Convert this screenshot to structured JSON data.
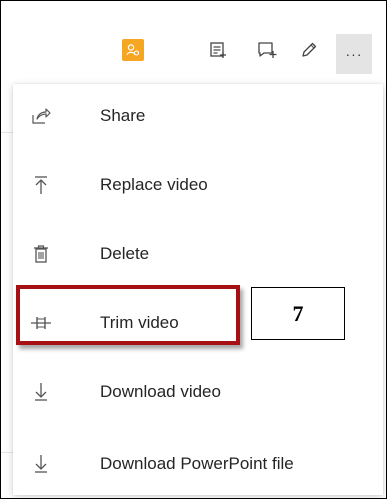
{
  "toolbar": {
    "icons": [
      "person-badge-icon",
      "notes-list-icon",
      "comment-add-icon",
      "pencil-icon"
    ],
    "more_label": "···"
  },
  "menu": {
    "items": [
      {
        "label": "Share",
        "icon": "share-icon"
      },
      {
        "label": "Replace video",
        "icon": "upload-icon"
      },
      {
        "label": "Delete",
        "icon": "trash-icon"
      },
      {
        "label": "Trim video",
        "icon": "trim-icon"
      },
      {
        "label": "Download video",
        "icon": "download-icon"
      },
      {
        "label": "Download PowerPoint file",
        "icon": "download-icon"
      }
    ]
  },
  "callout": {
    "number": "7"
  },
  "colors": {
    "accent": "#f5a623",
    "highlight": "#a60f14",
    "more_bg": "#e4e4e4"
  }
}
